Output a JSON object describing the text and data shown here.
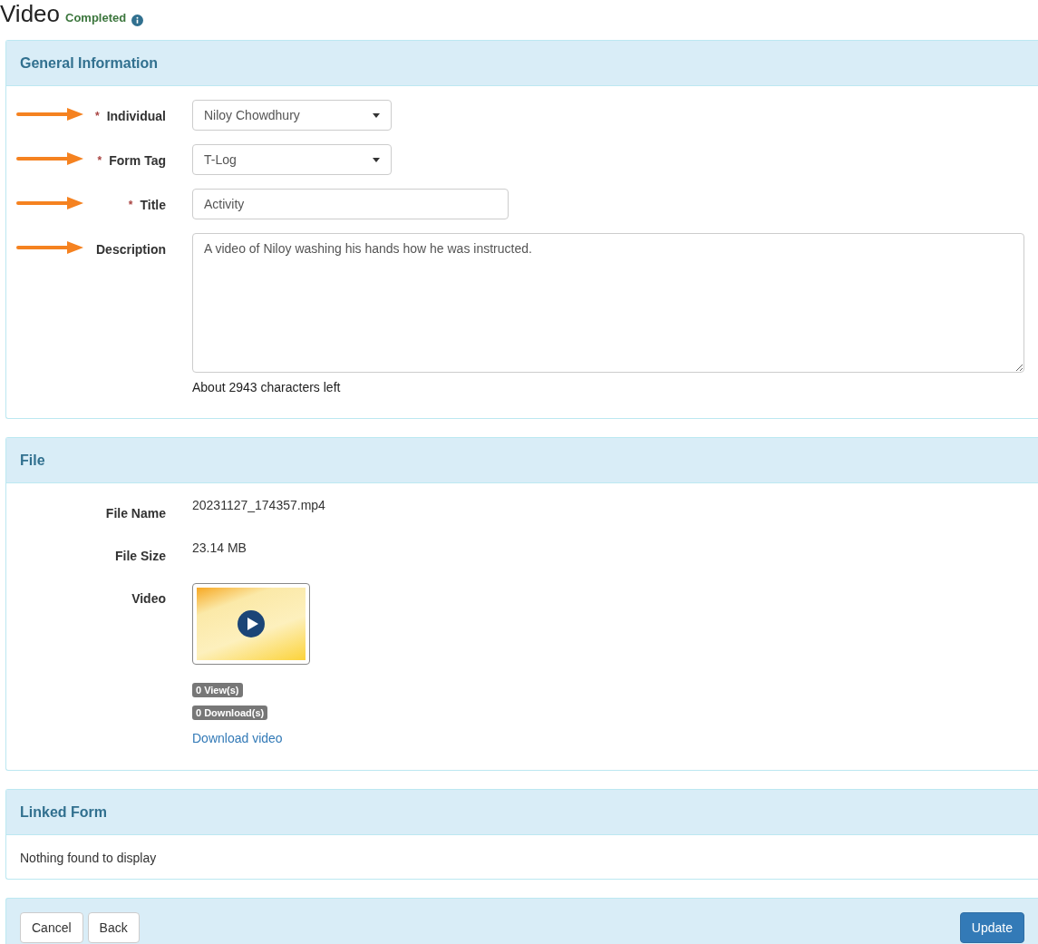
{
  "page": {
    "title": "Video",
    "status": "Completed"
  },
  "general_information": {
    "heading": "General Information",
    "fields": [
      {
        "kind": "select",
        "label": "Individual",
        "required_mark": "*",
        "arrow": true,
        "value": "Niloy Chowdhury"
      },
      {
        "kind": "select",
        "label": "Form Tag",
        "required_mark": "*",
        "arrow": true,
        "value": "T-Log"
      },
      {
        "kind": "input",
        "label": "Title",
        "required_mark": "*",
        "arrow": true,
        "value": "Activity"
      },
      {
        "kind": "textarea",
        "label": "Description",
        "arrow": true,
        "value": "A video of Niloy washing his hands how he was instructed.",
        "counter": "About 2943 characters left"
      }
    ]
  },
  "file": {
    "heading": "File",
    "rows": [
      {
        "kind": "text",
        "label": "File Name",
        "value": "20231127_174357.mp4"
      },
      {
        "kind": "text",
        "label": "File Size",
        "value": "23.14 MB"
      },
      {
        "kind": "video",
        "label": "Video",
        "badges": [
          "0 View(s)",
          "0 Download(s)"
        ],
        "link": "Download video"
      }
    ]
  },
  "linked_form": {
    "heading": "Linked Form",
    "message": "Nothing found to display"
  },
  "footer": {
    "buttons": [
      {
        "label": "Cancel",
        "kind": "default"
      },
      {
        "label": "Back",
        "kind": "default"
      },
      {
        "label": "Update",
        "kind": "primary"
      }
    ]
  }
}
